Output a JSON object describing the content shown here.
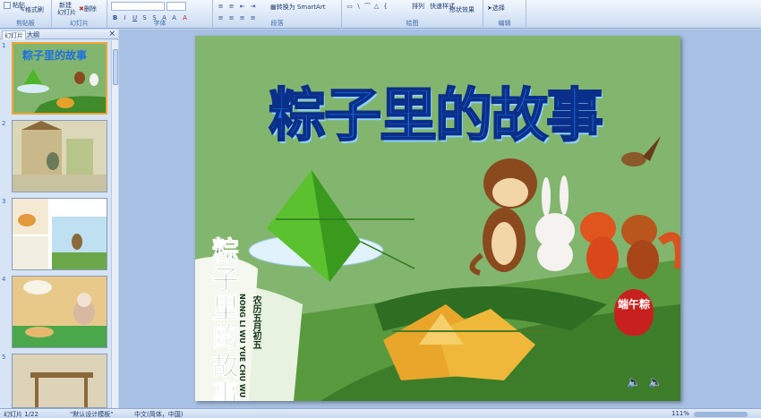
{
  "ribbon": {
    "clipboard": {
      "paste_label": "粘贴",
      "format_painter_label": "格式刷",
      "group_label": "剪贴板"
    },
    "slides": {
      "new_slide_label": "新建",
      "new_slide_label2": "幻灯片",
      "delete_label": "删除",
      "group_label": "幻灯片"
    },
    "font": {
      "group_label": "字体"
    },
    "paragraph": {
      "convert_smartart_label": "转换为 SmartArt",
      "group_label": "段落"
    },
    "drawing": {
      "arrange_label": "排列",
      "quick_styles_label": "快速样式",
      "shape_effects_label": "形状效果",
      "group_label": "绘图"
    },
    "editing": {
      "select_label": "选择",
      "group_label": "编辑"
    }
  },
  "panel": {
    "tab_slides": "幻灯片",
    "tab_outline": "大纲",
    "close_glyph": "×",
    "thumbnails": [
      {
        "number": "1",
        "selected": true,
        "mini_title": "粽子里的故事"
      },
      {
        "number": "2",
        "selected": false
      },
      {
        "number": "3",
        "selected": false
      },
      {
        "number": "4",
        "selected": false
      },
      {
        "number": "5",
        "selected": false
      }
    ]
  },
  "slide": {
    "title": "粽子里的故事",
    "vertical_title": [
      "粽",
      "子",
      "里",
      "的",
      "故",
      "事"
    ],
    "subtitle_cn": "农历五月初五",
    "subtitle_pinyin": "NONG LI WU YUE CHU WU",
    "seal_text": "端午粽",
    "sound_icon": "🔈"
  },
  "status": {
    "slide_indicator": "幻灯片 1/22",
    "theme": "\"默认设计模板\"",
    "language": "中文(简体，中国)",
    "zoom": "111%"
  },
  "colors": {
    "slide_background": "#82b66e",
    "title_blue": "#1e6fe0",
    "ribbon_blue": "#dbe7f7",
    "seal_red": "#c8201e"
  }
}
